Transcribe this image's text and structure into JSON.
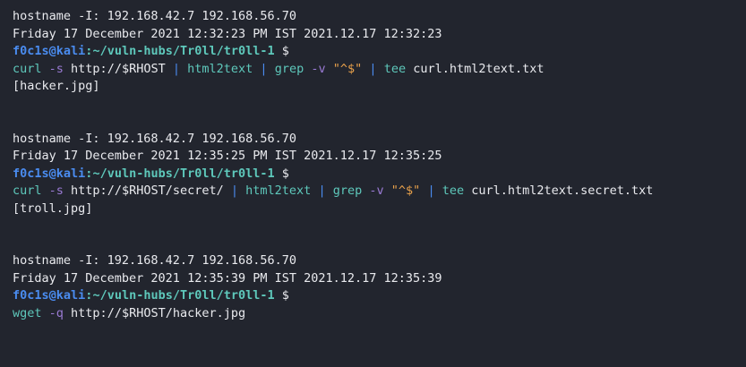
{
  "blocks": [
    {
      "hostname_line": "hostname -I: 192.168.42.7 192.168.56.70",
      "date_line": "Friday 17 December 2021 12:32:23 PM IST 2021.12.17 12:32:23",
      "prompt": {
        "user": "f0c1s",
        "at": "@",
        "host": "kali",
        "colon": ":",
        "path": "~/vuln-hubs/Tr0ll/tr0ll-1",
        "symbol": " $"
      },
      "command": [
        {
          "t": "cmd",
          "v": "curl"
        },
        {
          "t": "plain",
          "v": " "
        },
        {
          "t": "flag",
          "v": "-s"
        },
        {
          "t": "plain",
          "v": " http://$RHOST "
        },
        {
          "t": "pipe",
          "v": "|"
        },
        {
          "t": "plain",
          "v": " "
        },
        {
          "t": "cmd",
          "v": "html2text"
        },
        {
          "t": "plain",
          "v": " "
        },
        {
          "t": "pipe",
          "v": "|"
        },
        {
          "t": "plain",
          "v": " "
        },
        {
          "t": "cmd",
          "v": "grep"
        },
        {
          "t": "plain",
          "v": " "
        },
        {
          "t": "flag",
          "v": "-v"
        },
        {
          "t": "plain",
          "v": " "
        },
        {
          "t": "str",
          "v": "\"^$\""
        },
        {
          "t": "plain",
          "v": " "
        },
        {
          "t": "pipe",
          "v": "|"
        },
        {
          "t": "plain",
          "v": " "
        },
        {
          "t": "cmd",
          "v": "tee"
        },
        {
          "t": "plain",
          "v": " curl.html2text.txt"
        }
      ],
      "output": "[hacker.jpg]"
    },
    {
      "hostname_line": "hostname -I: 192.168.42.7 192.168.56.70",
      "date_line": "Friday 17 December 2021 12:35:25 PM IST 2021.12.17 12:35:25",
      "prompt": {
        "user": "f0c1s",
        "at": "@",
        "host": "kali",
        "colon": ":",
        "path": "~/vuln-hubs/Tr0ll/tr0ll-1",
        "symbol": " $"
      },
      "command": [
        {
          "t": "cmd",
          "v": "curl"
        },
        {
          "t": "plain",
          "v": " "
        },
        {
          "t": "flag",
          "v": "-s"
        },
        {
          "t": "plain",
          "v": " http://$RHOST/secret/ "
        },
        {
          "t": "pipe",
          "v": "|"
        },
        {
          "t": "plain",
          "v": " "
        },
        {
          "t": "cmd",
          "v": "html2text"
        },
        {
          "t": "plain",
          "v": " "
        },
        {
          "t": "pipe",
          "v": "|"
        },
        {
          "t": "plain",
          "v": " "
        },
        {
          "t": "cmd",
          "v": "grep"
        },
        {
          "t": "plain",
          "v": " "
        },
        {
          "t": "flag",
          "v": "-v"
        },
        {
          "t": "plain",
          "v": " "
        },
        {
          "t": "str",
          "v": "\"^$\""
        },
        {
          "t": "plain",
          "v": " "
        },
        {
          "t": "pipe",
          "v": "|"
        },
        {
          "t": "plain",
          "v": " "
        },
        {
          "t": "cmd",
          "v": "tee"
        },
        {
          "t": "plain",
          "v": " curl.html2text.secret.txt"
        }
      ],
      "output": "[troll.jpg]"
    },
    {
      "hostname_line": "hostname -I: 192.168.42.7 192.168.56.70",
      "date_line": "Friday 17 December 2021 12:35:39 PM IST 2021.12.17 12:35:39",
      "prompt": {
        "user": "f0c1s",
        "at": "@",
        "host": "kali",
        "colon": ":",
        "path": "~/vuln-hubs/Tr0ll/tr0ll-1",
        "symbol": " $"
      },
      "command": [
        {
          "t": "cmd",
          "v": "wget"
        },
        {
          "t": "plain",
          "v": " "
        },
        {
          "t": "flag",
          "v": "-q"
        },
        {
          "t": "plain",
          "v": " http://$RHOST/hacker.jpg"
        }
      ],
      "output": ""
    }
  ],
  "colors": {
    "background": "#22252e",
    "text": "#e9eaee",
    "user_host": "#4a8cf0",
    "path": "#5ec8bb",
    "command": "#5ec8bb",
    "flag": "#9a7ad4",
    "pipe": "#4a8cf0",
    "string": "#e7a04b"
  }
}
